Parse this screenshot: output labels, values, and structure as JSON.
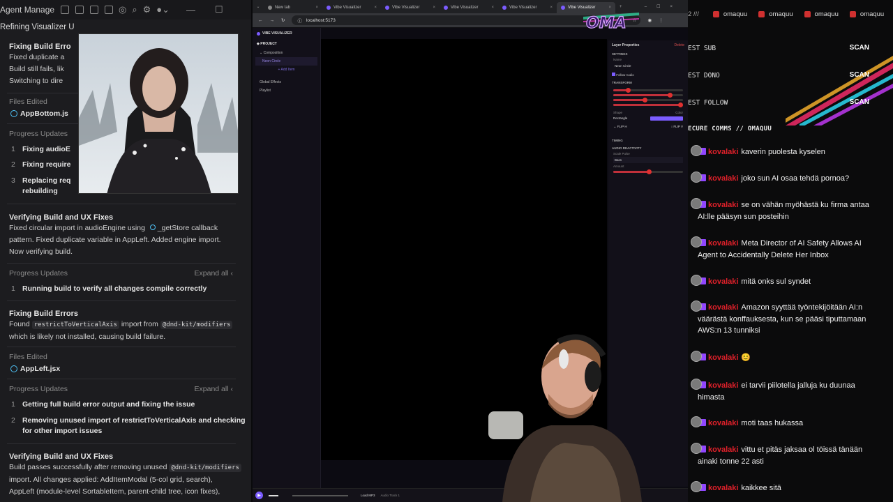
{
  "agent_manager": {
    "title": "Agent Manager",
    "subtitle": "Refining Visualizer U",
    "sections": [
      {
        "title": "Fixing Build Erro",
        "lines": [
          "Fixed duplicate a",
          "Build still fails, lik",
          "Switching to dire"
        ]
      },
      {
        "files_label": "Files Edited",
        "file": "AppBottom.js"
      },
      {
        "progress_label": "Progress Updates",
        "updates": [
          {
            "n": "1",
            "text": "Fixing audioE"
          },
          {
            "n": "2",
            "text": "Fixing require"
          },
          {
            "n": "3",
            "text": "Replacing req",
            "text2": "rebuilding"
          }
        ]
      },
      {
        "title": "Verifying Build and UX Fixes",
        "line1a": "Fixed circular import in audioEngine using",
        "line1b": "_getStore",
        "line1c": "callback",
        "line2": "pattern. Fixed duplicate variable in AppLeft. Added engine import.",
        "line3": "Now verifying build."
      },
      {
        "progress_label": "Progress Updates",
        "expand": "Expand all",
        "updates": [
          {
            "n": "1",
            "text": "Running build to verify all changes compile correctly"
          }
        ]
      },
      {
        "title": "Fixing Build Errors",
        "found": "Found",
        "code1": "restrictToVerticalAxis",
        "import_from": "import from",
        "code2": "@dnd-kit/modifiers",
        "line2": "which is likely not installed, causing build failure."
      },
      {
        "files_label": "Files Edited",
        "file": "AppLeft.jsx"
      },
      {
        "progress_label": "Progress Updates",
        "expand": "Expand all",
        "updates": [
          {
            "n": "1",
            "text": "Getting full build error output and fixing the issue"
          },
          {
            "n": "2",
            "text": "Removing unused import of restrictToVerticalAxis and checking",
            "text2": "for other import issues"
          }
        ]
      },
      {
        "title": "Verifying Build and UX Fixes",
        "line1a": "Build passes successfully after removing unused",
        "code": "@dnd-kit/modifiers",
        "line2": "import. All changes applied: AddItemModal (5-col grid, search),",
        "line3": "AppLeft (module-level SortableItem, parent-child tree, icon fixes),"
      }
    ]
  },
  "browser": {
    "tabs": [
      "New tab",
      "Vibe Visualizer",
      "Vibe Visualizer",
      "Vibe Visualizer",
      "Vibe Visualizer",
      "Vibe Visualizer"
    ],
    "active_tab": 5,
    "url": "localhost:5173",
    "app": {
      "brand": "VIBE VISUALIZER",
      "project": "PROJECT",
      "composition": "Composition",
      "selected_item": "Neon Circle",
      "add_item": "+ Add Item",
      "global_effects": "Global Effects",
      "playlist": "Playlist",
      "props_title": "Layer Properties",
      "delete": "Delete",
      "settings": "SETTINGS",
      "name_label": "Name",
      "name_value": "Neon Circle",
      "follow_audio": "Follow Audio",
      "transform": "TRANSFORM",
      "shape_label": "Shape",
      "shape_value": "Rectangle",
      "color_label": "Color",
      "flip_h": "↔ FLIP H",
      "flip_v": "↕ FLIP V",
      "timing": "TIMING",
      "audio_reactivity": "AUDIO REACTIVITY",
      "scale_pulse": "Scale Pulse",
      "band_value": "Bass",
      "amount_label": "Amount",
      "load_mp3": "Load MP3",
      "audio_track": "Audio Track 1",
      "accent": "#7b5cff"
    }
  },
  "chat": {
    "top_user": "omaquu",
    "alerts": [
      {
        "label": "EST SUB",
        "action": "SCAN"
      },
      {
        "label": "EST DONO",
        "action": "SCAN"
      },
      {
        "label": "EST FOLLOW",
        "action": "SCAN"
      }
    ],
    "channel": "ECURE COMMS // OMAQUU",
    "username": "kovalaki",
    "messages": [
      {
        "text": "kaverin puolesta kyselen",
        "cont": ""
      },
      {
        "text": "joko sun AI osaa tehdä pornoa?",
        "cont": ""
      },
      {
        "text": "se on vähän myöhästä ku firma antaa",
        "cont": "AI:lle pääsyn sun posteihin"
      },
      {
        "text": "Meta Director of AI Safety Allows AI",
        "cont": "Agent to Accidentally Delete Her Inbox"
      },
      {
        "text": "mitä onks sul syndet",
        "cont": ""
      },
      {
        "text": "Amazon syyttää työntekijöitään AI:n",
        "cont": "väärästä konffauksesta, kun se pääsi tiputtamaan",
        "cont2": "AWS:n 13 tunniksi"
      },
      {
        "text": "😊",
        "cont": ""
      },
      {
        "text": "ei tarvii piilotella jalluja ku duunaa",
        "cont": "himasta"
      },
      {
        "text": "moti taas hukassa",
        "cont": ""
      },
      {
        "text": "vittu et pitäs jaksaa ol töissä tänään",
        "cont": "ainaki tonne 22 asti"
      },
      {
        "text": "kaikkee sitä",
        "cont": ""
      }
    ]
  },
  "overlay": {
    "logo": "OMA"
  }
}
